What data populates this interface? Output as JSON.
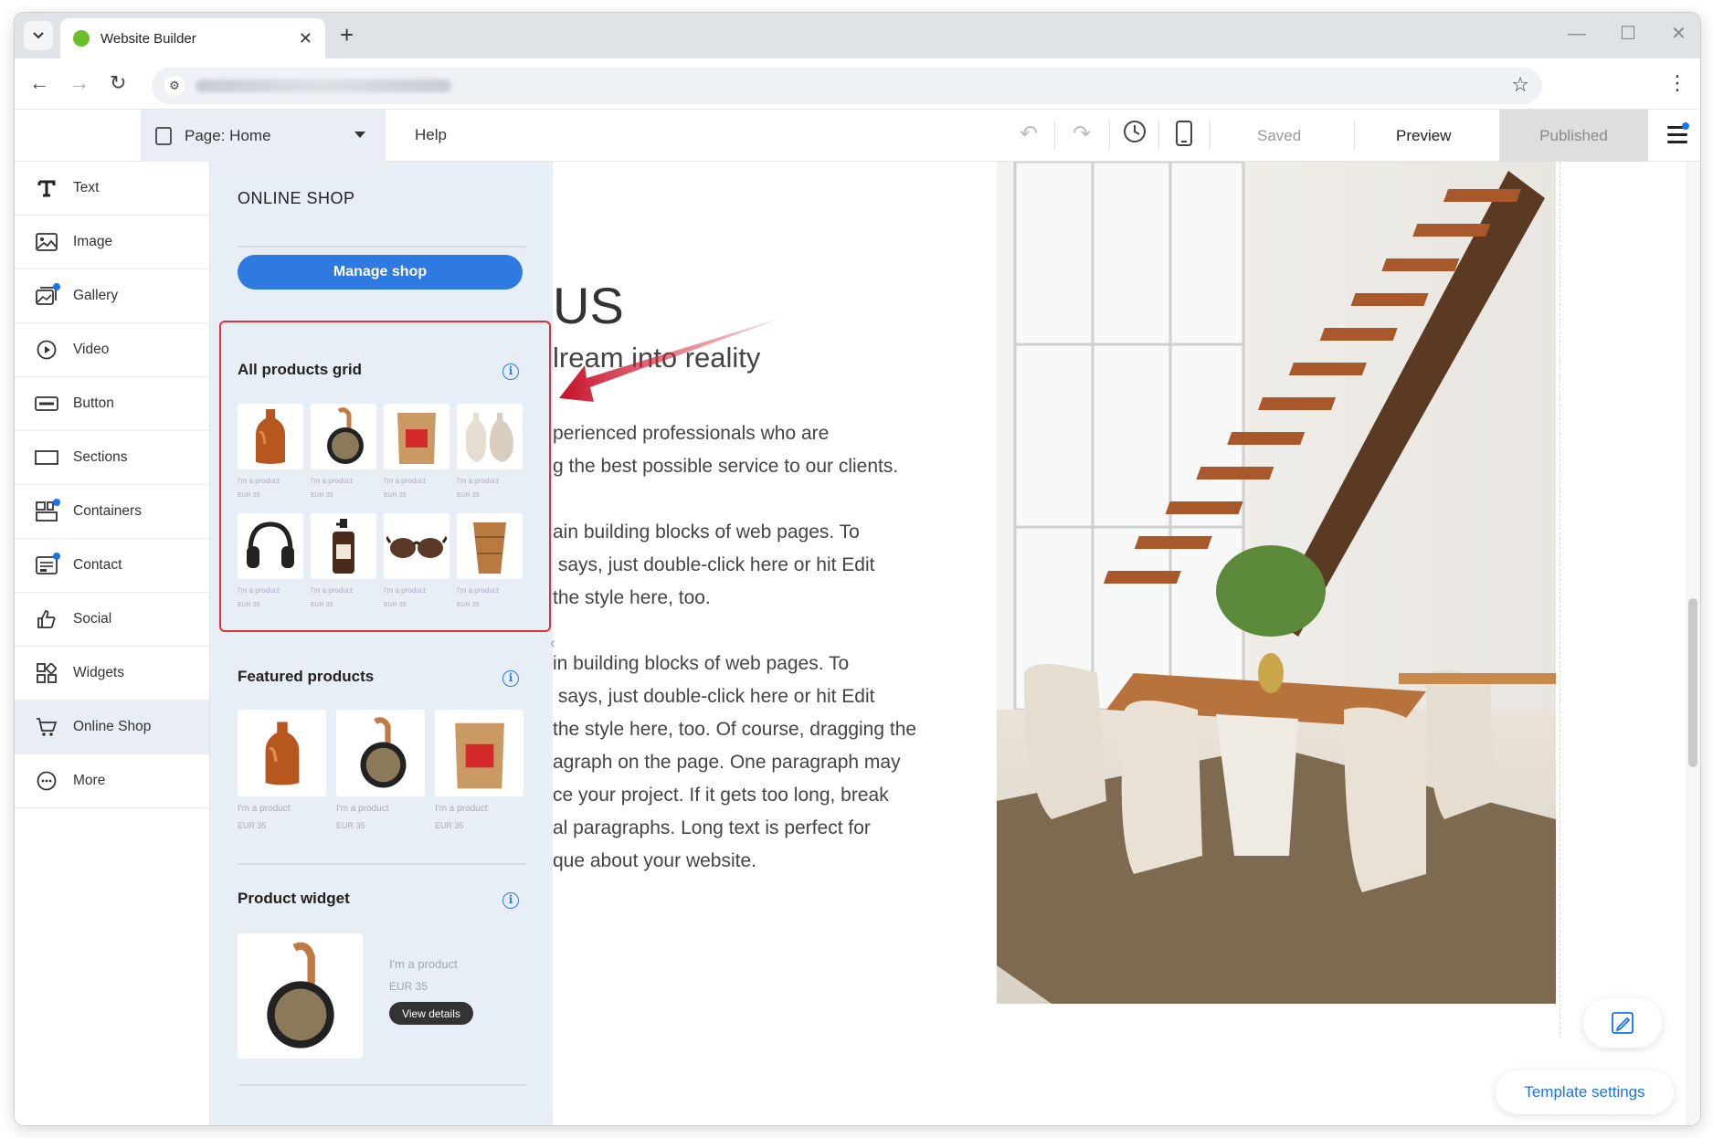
{
  "browser": {
    "tab_title": "Website Builder",
    "new_tab": "+",
    "tab_close": "✕"
  },
  "editor": {
    "page_label": "Page:",
    "page_name": "Home",
    "help": "Help",
    "saved": "Saved",
    "preview": "Preview",
    "published": "Published"
  },
  "sidebar": {
    "items": [
      {
        "label": "Text",
        "icon": "text-icon"
      },
      {
        "label": "Image",
        "icon": "image-icon"
      },
      {
        "label": "Gallery",
        "icon": "gallery-icon"
      },
      {
        "label": "Video",
        "icon": "video-icon"
      },
      {
        "label": "Button",
        "icon": "button-icon"
      },
      {
        "label": "Sections",
        "icon": "sections-icon"
      },
      {
        "label": "Containers",
        "icon": "containers-icon"
      },
      {
        "label": "Contact",
        "icon": "contact-icon"
      },
      {
        "label": "Social",
        "icon": "thumbs-up-icon"
      },
      {
        "label": "Widgets",
        "icon": "widgets-icon"
      },
      {
        "label": "Online Shop",
        "icon": "cart-icon"
      },
      {
        "label": "More",
        "icon": "more-icon"
      }
    ]
  },
  "panel": {
    "title": "ONLINE SHOP",
    "manage_button": "Manage shop",
    "grid_section": {
      "title": "All products grid",
      "items": [
        {
          "name": "I'm a product",
          "price": "EUR 35",
          "img": "vase-amber"
        },
        {
          "name": "I'm a product",
          "price": "EUR 35",
          "img": "speaker"
        },
        {
          "name": "I'm a product",
          "price": "EUR 35",
          "img": "coffee-bag"
        },
        {
          "name": "I'm a product",
          "price": "EUR 35",
          "img": "ceramic-vases"
        },
        {
          "name": "I'm a product",
          "price": "EUR 35",
          "img": "headphones"
        },
        {
          "name": "I'm a product",
          "price": "EUR 35",
          "img": "soap-bottle"
        },
        {
          "name": "I'm a product",
          "price": "EUR 35",
          "img": "sunglasses"
        },
        {
          "name": "I'm a product",
          "price": "EUR 35",
          "img": "wooden-cups"
        }
      ]
    },
    "featured_section": {
      "title": "Featured products",
      "items": [
        {
          "name": "I'm a product",
          "price": "EUR 35"
        },
        {
          "name": "I'm a product",
          "price": "EUR 35"
        },
        {
          "name": "I'm a product",
          "price": "EUR 35"
        }
      ]
    },
    "widget_section": {
      "title": "Product widget",
      "name": "I'm a product",
      "price": "EUR 35",
      "button": "View details"
    },
    "info_glyph": "i"
  },
  "canvas": {
    "heading": "US",
    "subheading": "lream into reality",
    "paragraphs": [
      "perienced professionals who are\ng the best possible service to our clients.",
      "ain building blocks of web pages. To\n says, just double-click here or hit Edit\nthe style here, too.",
      "in building blocks of web pages. To\n says, just double-click here or hit Edit\nthe style here, too. Of course, dragging the\nagraph on the page. One paragraph may\nce your project. If it gets too long, break\nal paragraphs. Long text is perfect for\nque about your website."
    ],
    "template_settings": "Template settings"
  },
  "colors": {
    "accent": "#2f7ae0",
    "highlight": "#e0303a",
    "panel_bg": "#e7eef6"
  }
}
